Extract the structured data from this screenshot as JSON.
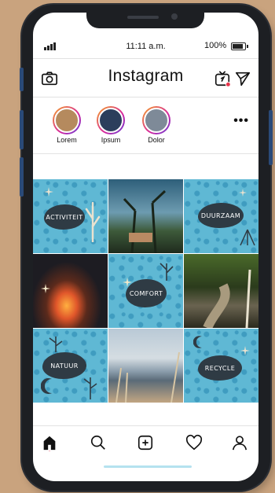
{
  "status_bar": {
    "time": "11:11 a.m.",
    "battery": "100%"
  },
  "header": {
    "title": "Instagram",
    "left_icon": "camera-icon",
    "right_icons": [
      "igtv-icon",
      "direct-send-icon"
    ]
  },
  "stories": [
    {
      "label": "Lorem",
      "color": "#b58a5e"
    },
    {
      "label": "Ipsum",
      "color": "#2c3e5c"
    },
    {
      "label": "Dolor",
      "color": "#7e8a98"
    }
  ],
  "stories_more": "•••",
  "grid": {
    "tiles": [
      {
        "kind": "label",
        "text": "ACTIVITEIT"
      },
      {
        "kind": "photo",
        "subject": "trees"
      },
      {
        "kind": "label",
        "text": "DUURZAAM"
      },
      {
        "kind": "photo",
        "subject": "campfire"
      },
      {
        "kind": "label",
        "text": "COMFORT"
      },
      {
        "kind": "photo",
        "subject": "forest-path"
      },
      {
        "kind": "label",
        "text": "NATUUR"
      },
      {
        "kind": "photo",
        "subject": "lake"
      },
      {
        "kind": "label",
        "text": "RECYCLE"
      }
    ]
  },
  "nav": [
    "home-icon",
    "search-icon",
    "add-post-icon",
    "heart-icon",
    "profile-icon"
  ],
  "colors": {
    "tile_blue": "#5fb8d4",
    "blob": "#2f3b44",
    "notification": "#e8344b"
  }
}
